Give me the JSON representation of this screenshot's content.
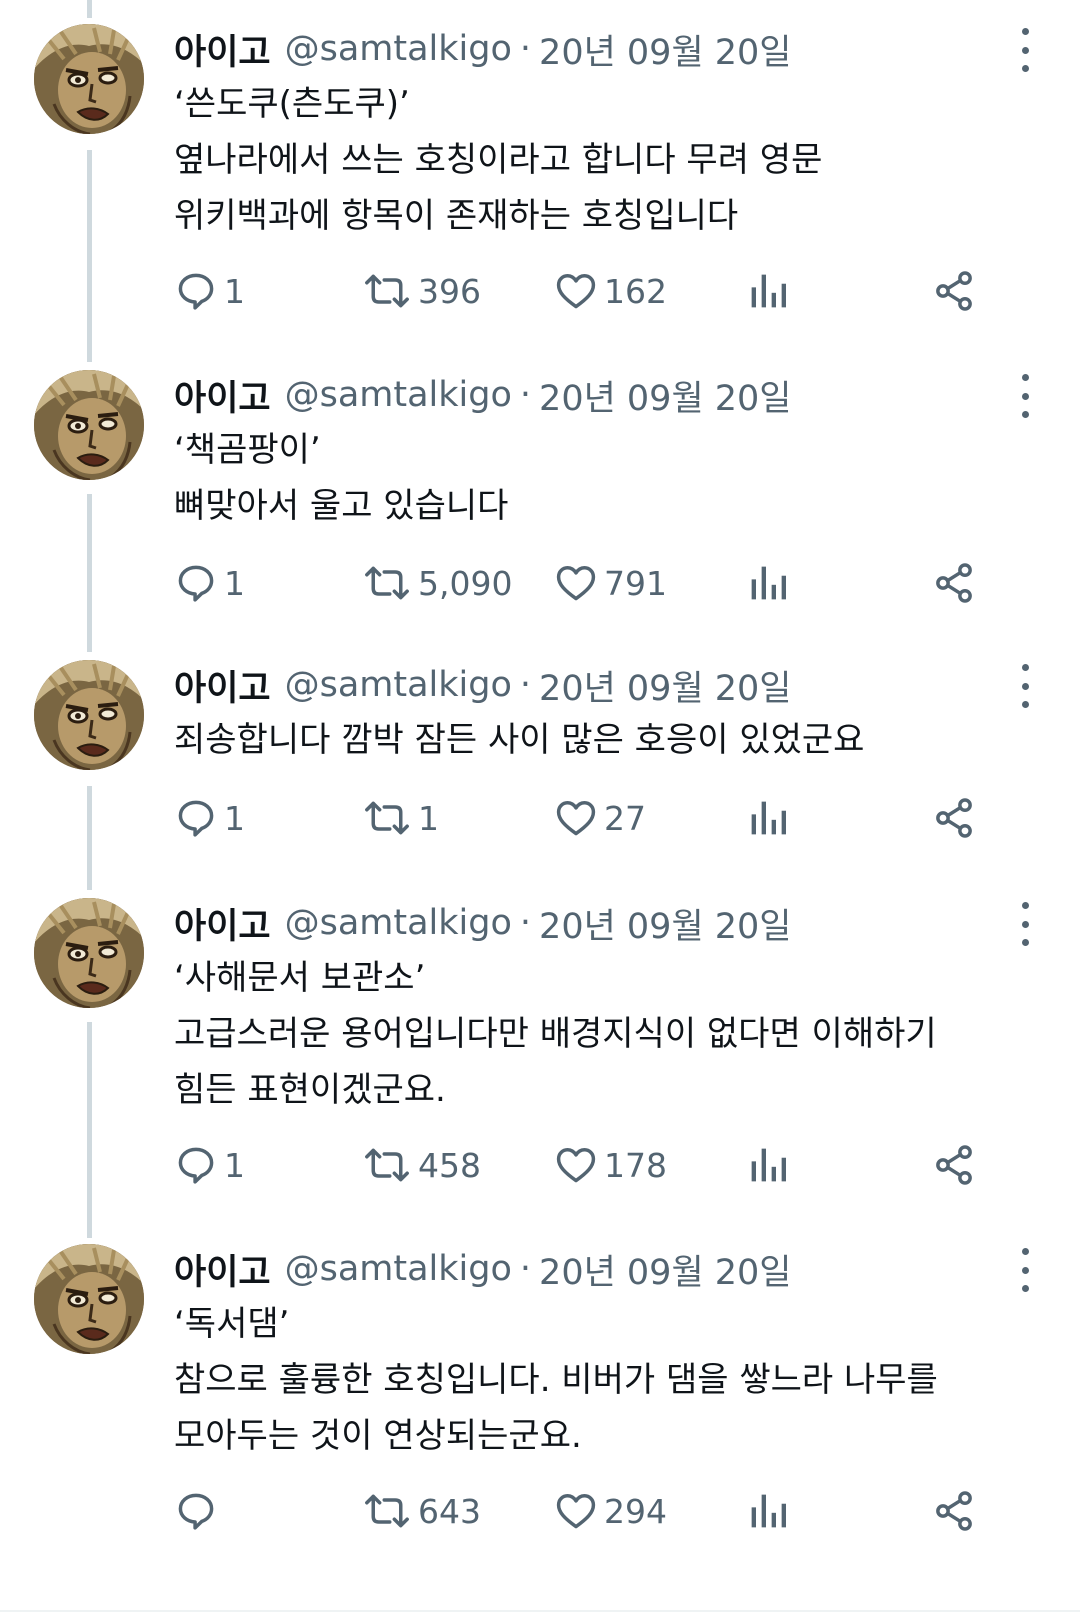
{
  "tweets": [
    {
      "author": "아이고",
      "handle": "@samtalkigo",
      "separator": "·",
      "date": "20년 09월 20일",
      "lines": [
        "‘쓴도쿠(츤도쿠)’",
        "옆나라에서 쓰는 호칭이라고 합니다 무려 영문",
        "위키백과에 항목이 존재하는 호칭입니다"
      ],
      "replies": "1",
      "retweets": "396",
      "likes": "162"
    },
    {
      "author": "아이고",
      "handle": "@samtalkigo",
      "separator": "·",
      "date": "20년 09월 20일",
      "lines": [
        "‘책곰팡이’",
        "뼈맞아서 울고 있습니다"
      ],
      "replies": "1",
      "retweets": "5,090",
      "likes": "791"
    },
    {
      "author": "아이고",
      "handle": "@samtalkigo",
      "separator": "·",
      "date": "20년 09월 20일",
      "lines": [
        "죄송합니다 깜박 잠든 사이 많은 호응이 있었군요"
      ],
      "replies": "1",
      "retweets": "1",
      "likes": "27"
    },
    {
      "author": "아이고",
      "handle": "@samtalkigo",
      "separator": "·",
      "date": "20년 09월 20일",
      "lines": [
        "‘사해문서 보관소’",
        "고급스러운 용어입니다만 배경지식이 없다면 이해하기",
        "힘든 표현이겠군요."
      ],
      "replies": "1",
      "retweets": "458",
      "likes": "178"
    },
    {
      "author": "아이고",
      "handle": "@samtalkigo",
      "separator": "·",
      "date": "20년 09월 20일",
      "lines": [
        "‘독서댐’",
        "참으로 훌륭한 호칭입니다. 비버가 댐을 쌓느라 나무를",
        "모아두는 것이 연상되는군요."
      ],
      "replies": "",
      "retweets": "643",
      "likes": "294"
    }
  ],
  "colors": {
    "text": "#0f1419",
    "secondary": "#536471",
    "thread_line": "#cfd9de",
    "avatar_bg": "#7a6642"
  },
  "icons": {
    "reply": "speech-bubble-icon",
    "retweet": "retweet-arrows-icon",
    "like": "heart-icon",
    "views": "bar-chart-icon",
    "share": "share-nodes-icon",
    "more": "vertical-ellipsis-icon"
  }
}
